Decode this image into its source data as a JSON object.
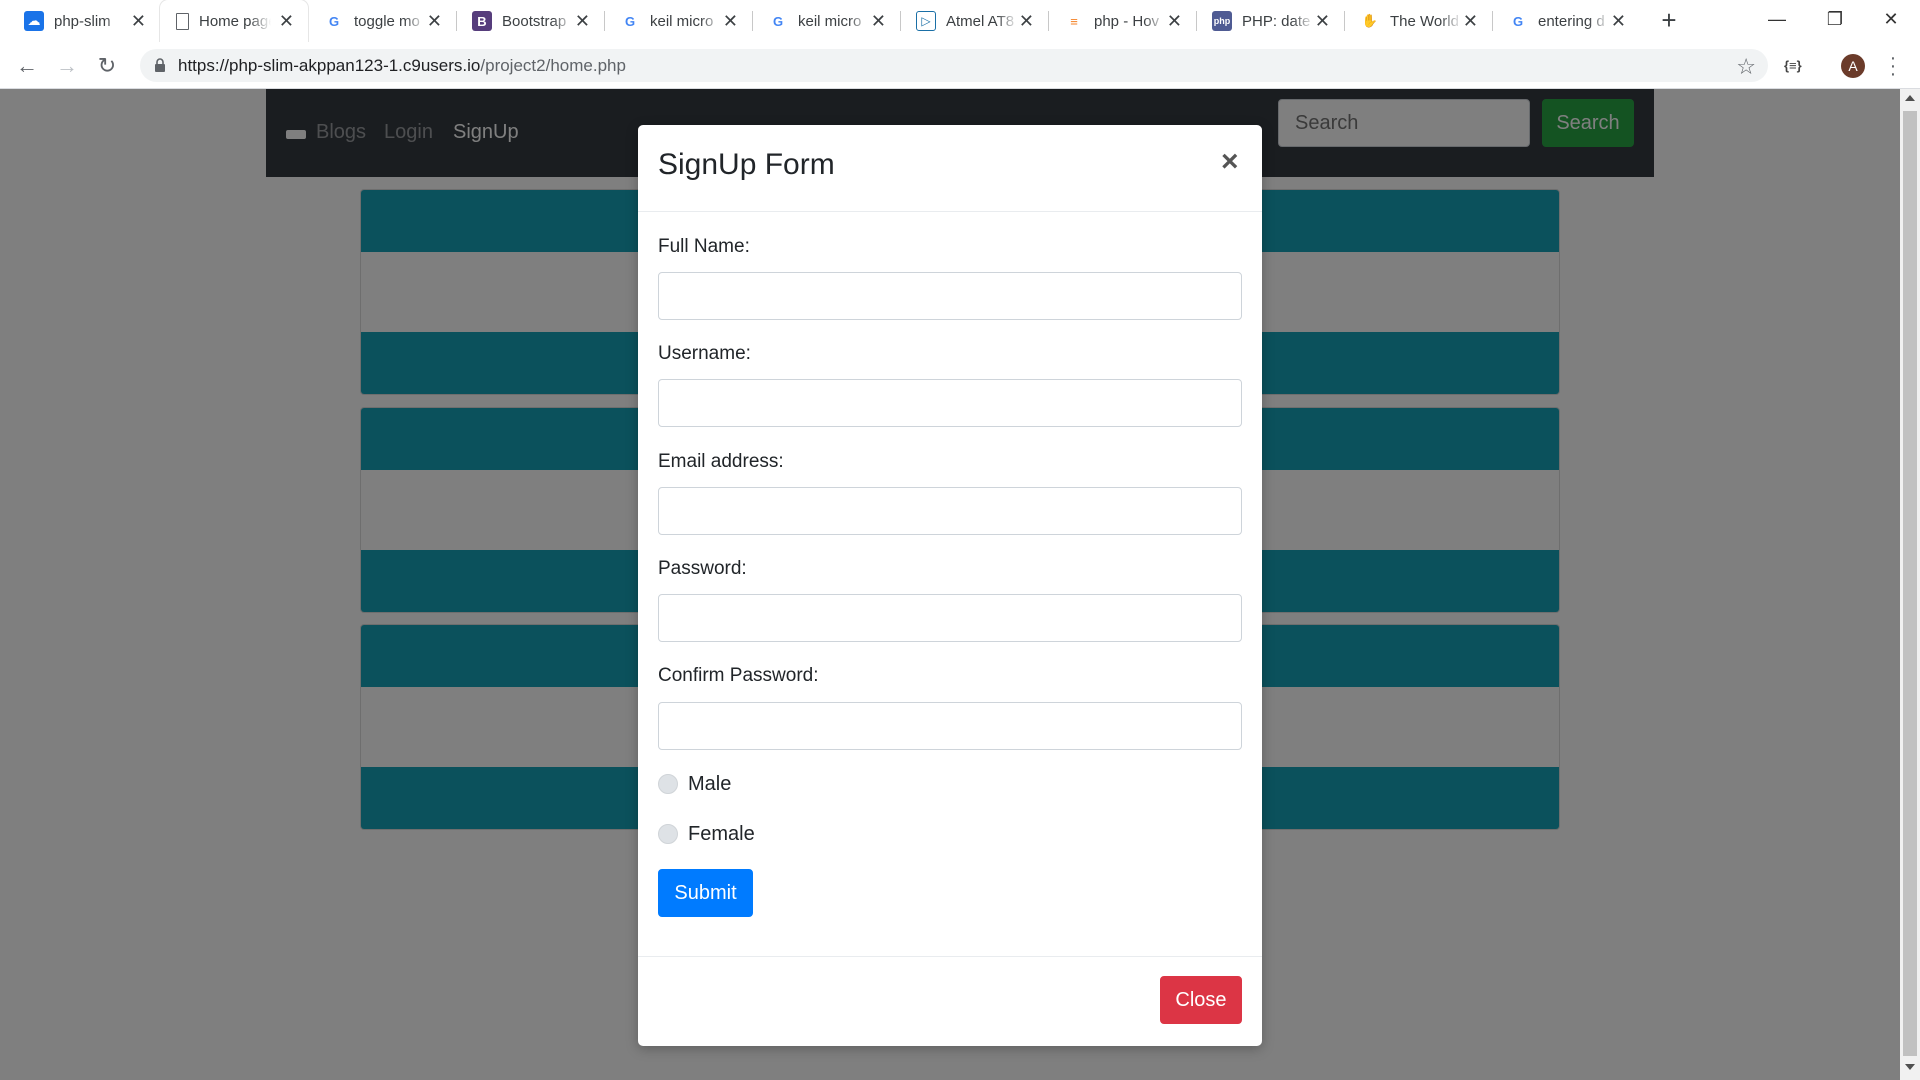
{
  "browser": {
    "tabs": [
      {
        "title": "php-slim",
        "icon": "cloud9-icon",
        "color": "#1a73e8"
      },
      {
        "title": "Home page",
        "icon": "page-icon",
        "color": "#5f6368"
      },
      {
        "title": "toggle mo",
        "icon": "google-icon",
        "color": "#4285f4"
      },
      {
        "title": "Bootstrap",
        "icon": "bootstrap-icon",
        "color": "#563d7c"
      },
      {
        "title": "keil micro",
        "icon": "google-icon",
        "color": "#4285f4"
      },
      {
        "title": "keil micro",
        "icon": "google-icon",
        "color": "#4285f4"
      },
      {
        "title": "Atmel AT8",
        "icon": "atmel-icon",
        "color": "#1a6fa6"
      },
      {
        "title": "php - Hov",
        "icon": "stackoverflow-icon",
        "color": "#f48024"
      },
      {
        "title": "PHP: date",
        "icon": "php-icon",
        "color": "#4f5b93"
      },
      {
        "title": "The World",
        "icon": "hands-icon",
        "color": "#9c27b0"
      },
      {
        "title": "entering d",
        "icon": "google-icon",
        "color": "#4285f4"
      }
    ],
    "url_host": "https://php-slim-akppan123-1.c9users.io",
    "url_path": "/project2/home.php",
    "profile_initial": "A"
  },
  "navbar": {
    "links": [
      "Blogs",
      "Login",
      "SignUp"
    ],
    "search_placeholder": "Search",
    "search_button": "Search"
  },
  "modal": {
    "title": "SignUp Form",
    "close_symbol": "×",
    "fields": [
      {
        "label": "Full Name:",
        "value": ""
      },
      {
        "label": "Username:",
        "value": ""
      },
      {
        "label": "Email address:",
        "value": ""
      },
      {
        "label": "Password:",
        "value": ""
      },
      {
        "label": "Confirm Password:",
        "value": ""
      }
    ],
    "gender_options": [
      "Male",
      "Female"
    ],
    "submit_label": "Submit",
    "close_label": "Close"
  },
  "colors": {
    "navbar": "#343a40",
    "card_header": "#17a2b8",
    "search_button": "#28a745",
    "submit_button": "#007bff",
    "close_button": "#dc3545"
  }
}
